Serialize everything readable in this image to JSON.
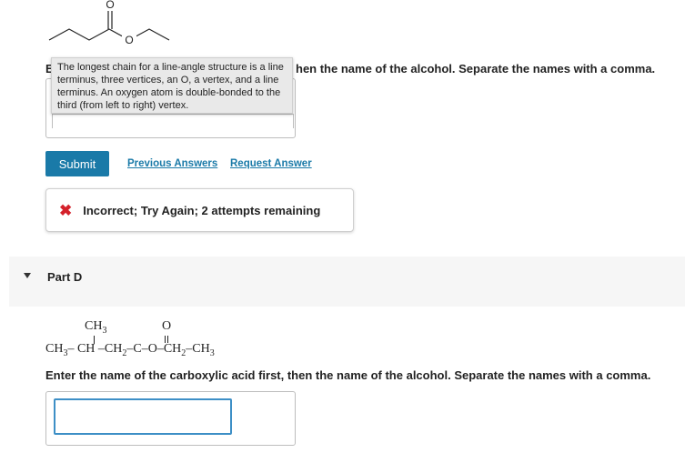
{
  "part_c": {
    "instruction_prefix": "E",
    "instruction_suffix": "hen the name of the alcohol. Separate the names with a comma.",
    "tooltip_text": "The longest chain for a line-angle structure is a line terminus, three vertices, an O, a vertex, and a line terminus. An oxygen atom is double-bonded to the third (from left to right) vertex.",
    "answer_value": ""
  },
  "actions": {
    "submit_label": "Submit",
    "previous_answers_label": "Previous Answers",
    "request_answer_label": "Request Answer"
  },
  "feedback": {
    "icon": "x-icon",
    "text": "Incorrect; Try Again; 2 attempts remaining",
    "color": "#d4212b"
  },
  "part_d": {
    "label": "Part D",
    "formula": {
      "top_ch3": "CH",
      "top_ch3_sub": "3",
      "top_o": "O",
      "main_ch3_left": "CH",
      "main_ch3_left_sub": "3",
      "dash1": "–",
      "ch": "CH",
      "dash2": "–",
      "ch2_a": "CH",
      "ch2_a_sub": "2",
      "dash3": "–",
      "c": "C",
      "dash4": "–",
      "o": "O",
      "dash5": "–",
      "ch2_b": "CH",
      "ch2_b_sub": "2",
      "dash6": "–",
      "ch3_right": "CH",
      "ch3_right_sub": "3"
    },
    "instruction": "Enter the name of the carboxylic acid first, then the name of the alcohol. Separate the names with a comma.",
    "answer_value": ""
  },
  "colors": {
    "accent": "#1a7aa8",
    "input_focus": "#3d8fc6",
    "error": "#d4212b"
  }
}
